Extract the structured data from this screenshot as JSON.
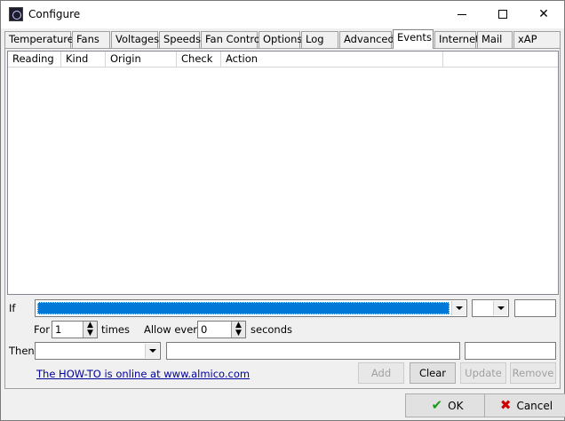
{
  "window": {
    "title": "Configure",
    "icon": "fan-icon",
    "controls": [
      "minimize",
      "maximize",
      "close"
    ]
  },
  "tabs": [
    {
      "label": "Temperatures"
    },
    {
      "label": "Fans"
    },
    {
      "label": "Voltages"
    },
    {
      "label": "Speeds"
    },
    {
      "label": "Fan Control"
    },
    {
      "label": "Options"
    },
    {
      "label": "Log"
    },
    {
      "label": "Advanced"
    },
    {
      "label": "Events",
      "active": true
    },
    {
      "label": "Internet"
    },
    {
      "label": "Mail"
    },
    {
      "label": "xAP"
    }
  ],
  "events_list": {
    "columns": [
      "Reading",
      "Kind",
      "Origin",
      "Check",
      "Action"
    ],
    "rows": []
  },
  "if_row": {
    "label": "If",
    "condition_value": "",
    "operator_value": "",
    "threshold_value": ""
  },
  "for_row": {
    "for_label": "For",
    "times_value": "1",
    "times_label": "times",
    "allow_label": "Allow every",
    "seconds_value": "0",
    "seconds_label": "seconds"
  },
  "then_row": {
    "label": "Then",
    "action_value": "",
    "param1": "",
    "param2": ""
  },
  "howto_link": "The HOW-TO is online at www.almico.com",
  "actions": {
    "add": "Add",
    "clear": "Clear",
    "update": "Update",
    "remove": "Remove"
  },
  "dialog_buttons": {
    "ok": "OK",
    "cancel": "Cancel"
  }
}
